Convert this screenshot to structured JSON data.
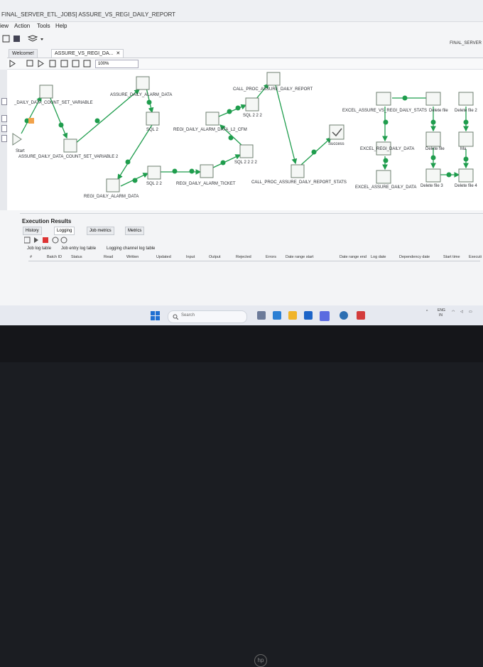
{
  "window": {
    "title": "FINAL_SERVER_ETL_JOBS] ASSURE_VS_REGI_DAILY_REPORT",
    "perspective": "FINAL_SERVER"
  },
  "menu": [
    "iew",
    "Action",
    "Tools",
    "Help"
  ],
  "tabs": [
    {
      "label": "Welcome!"
    },
    {
      "label": "ASSURE_VS_REGI_DA..."
    }
  ],
  "zoom": "100%",
  "nodes": {
    "start": "Start",
    "daily_count_set": "_DAILY_DATA_COUNT_SET_VARIABLE",
    "assure_count_set2": "ASSURE_DAILY_DATA_COUNT_SET_VARIABLE 2",
    "assure_alarm": "ASSURE_DAILY_ALARM_DATA",
    "sql2": "SQL 2",
    "regi_alarm": "REGI_DAILY_ALARM_DATA",
    "sql22": "SQL 2 2",
    "regi_ticket": "REGI_DAILY_ALARM_TICKET",
    "regi_l2": "REGI_DAILY_ALARM_DATA_L2_CFM",
    "sql222": "SQL 2 2 2",
    "sql2222": "SQL 2 2 2 2",
    "call_proc": "CALL_PROC_ASSURE_DAILY_REPORT",
    "call_proc_stats": "CALL_PROC_ASSURE_DAILY_REPORT_STATS",
    "success": "Success",
    "excel_vs": "EXCEL_ASSURE_VS_REGI_DAILY_STATS",
    "excel_regi": "EXCEL_REGI_DAILY_DATA",
    "excel_assure": "EXCEL_ASSURE_DAILY_DATA",
    "del1": "Delete file",
    "del2": "Delete file 2",
    "del_file": "Delete file",
    "del3": "Delete file 3",
    "del4": "Delete file 4",
    "mail": "Ma"
  },
  "results": {
    "title": "Execution Results",
    "tabs": [
      "History",
      "Logging",
      "Job metrics",
      "Metrics"
    ],
    "subtabs": [
      "Job log table",
      "Job entry log table",
      "Logging channel log table"
    ],
    "columns": [
      "#",
      "Batch ID",
      "Status",
      "Read",
      "Written",
      "Updated",
      "Input",
      "Output",
      "Rejected",
      "Errors",
      "Date range start",
      "Date range end",
      "Log date",
      "Dependency date",
      "Start time",
      "Executi"
    ]
  },
  "taskbar": {
    "search_placeholder": "Search",
    "lang": "ENG",
    "region": "IN"
  },
  "colors": {
    "hop_green": "#1f9d4d",
    "node_border": "#7a8a7a",
    "tab_active": "#ffffff"
  }
}
